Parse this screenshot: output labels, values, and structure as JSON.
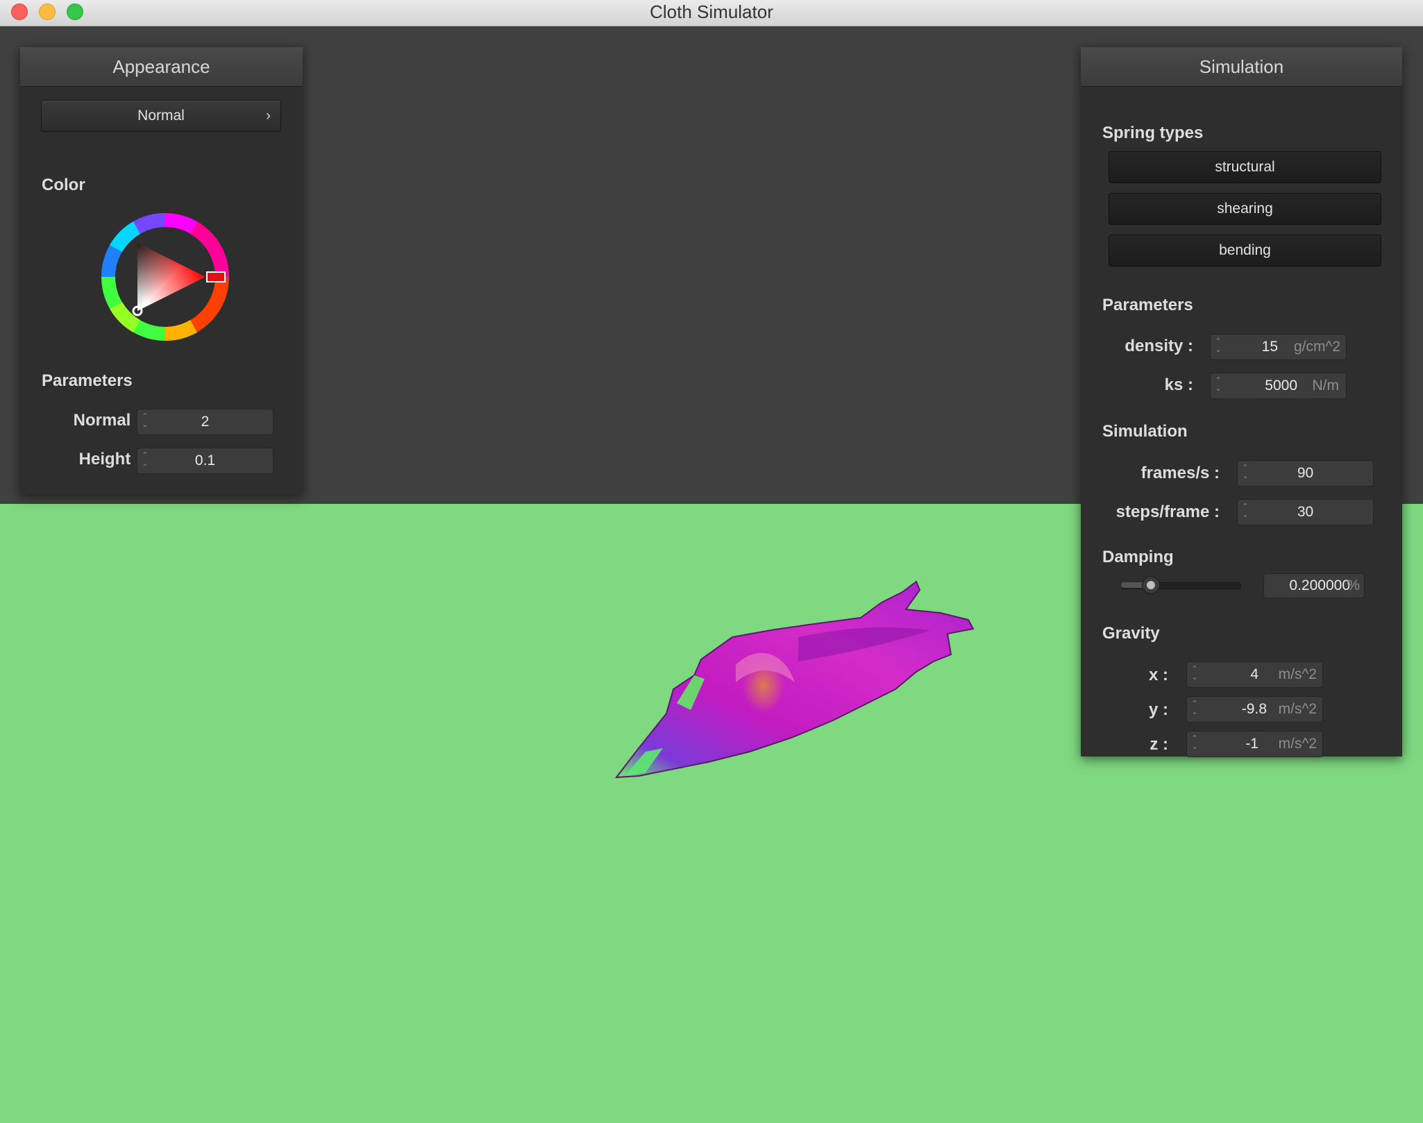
{
  "window": {
    "title": "Cloth Simulator"
  },
  "appearance": {
    "title": "Appearance",
    "shader_select": {
      "value": "Normal",
      "arrow": "›"
    },
    "color_label": "Color",
    "color_picker": {
      "hue_color": "#ff0000"
    },
    "parameters_label": "Parameters",
    "normal": {
      "label": "Normal :",
      "value": "2"
    },
    "height": {
      "label": "Height :",
      "value": "0.1"
    }
  },
  "simulation": {
    "title": "Simulation",
    "spring_types_label": "Spring types",
    "spring_buttons": [
      "structural",
      "shearing",
      "bending"
    ],
    "parameters_label": "Parameters",
    "density": {
      "label": "density :",
      "value": "15",
      "unit": "g/cm^2"
    },
    "ks": {
      "label": "ks :",
      "value": "5000",
      "unit": "N/m"
    },
    "simulation_label": "Simulation",
    "frames_per_s": {
      "label": "frames/s :",
      "value": "90"
    },
    "steps_per_frame": {
      "label": "steps/frame :",
      "value": "30"
    },
    "damping_label": "Damping",
    "damping": {
      "value": "0.200000",
      "unit": "%",
      "slider_fraction": 0.2
    },
    "gravity_label": "Gravity",
    "gravity": {
      "x": {
        "label": "x :",
        "value": "4",
        "unit": "m/s^2"
      },
      "y": {
        "label": "y :",
        "value": "-9.8",
        "unit": "m/s^2"
      },
      "z": {
        "label": "z :",
        "value": "-1",
        "unit": "m/s^2"
      }
    }
  },
  "scene": {
    "floor_color": "#7fd981",
    "cloth_color": "#c81cc8"
  },
  "icons": {
    "spinner": "chevron-up-down-icon"
  }
}
